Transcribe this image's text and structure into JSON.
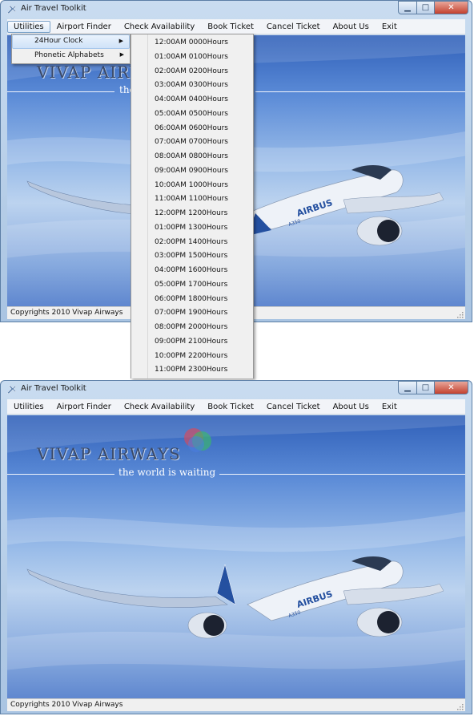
{
  "window": {
    "title": "Air Travel Toolkit"
  },
  "icons": {
    "app": "airplane-icon",
    "minimize": "minimize-icon",
    "maximize": "maximize-icon",
    "close": "close-icon",
    "submenu_arrow": "chevron-right-icon",
    "grip": "resize-grip-icon"
  },
  "menu": [
    {
      "label": "Utilities"
    },
    {
      "label": "Airport Finder"
    },
    {
      "label": "Check Availability"
    },
    {
      "label": "Book Ticket"
    },
    {
      "label": "Cancel Ticket"
    },
    {
      "label": "About Us"
    },
    {
      "label": "Exit"
    }
  ],
  "utilities_submenu": [
    {
      "label": "24Hour Clock"
    },
    {
      "label": "Phonetic Alphabets"
    }
  ],
  "clock_menu": [
    "12:00AM  0000Hours",
    "01:00AM  0100Hours",
    "02:00AM  0200Hours",
    "03:00AM  0300Hours",
    "04:00AM 0400Hours",
    "05:00AM  0500Hours",
    "06:00AM  0600Hours",
    "07:00AM  0700Hours",
    "08:00AM  0800Hours",
    "09:00AM  0900Hours",
    "10:00AM  1000Hours",
    "11:00AM  1100Hours",
    "12:00PM  1200Hours",
    "01:00PM  1300Hours",
    "02:00PM  1400Hours",
    "03:00PM  1500Hours",
    "04:00PM  1600Hours",
    "05:00PM  1700Hours",
    "06:00PM  1800Hours",
    "07:00PM  1900Hours",
    "08:00PM  2000Hours",
    "09:00PM  2100Hours",
    "10:00PM  2200Hours",
    "11:00PM  2300Hours"
  ],
  "banner": {
    "brand": "VIVAP AIRWAYS",
    "brand_partial": "VIVAP AIRW",
    "tagline": "the world is waiting",
    "tagline_partial": "the"
  },
  "aircraft": {
    "brand_text": "AIRBUS",
    "model_text": "A350"
  },
  "status": {
    "text": "Copyrights 2010 Vivap Airways"
  },
  "colors": {
    "frame": "#a9c4e2",
    "sky_top": "#2f5fb8",
    "sky_light": "#bcd3ef",
    "menubar": "#f2f4f8",
    "close_button": "#c3412e",
    "menu_highlight": "#cfe2f8"
  }
}
